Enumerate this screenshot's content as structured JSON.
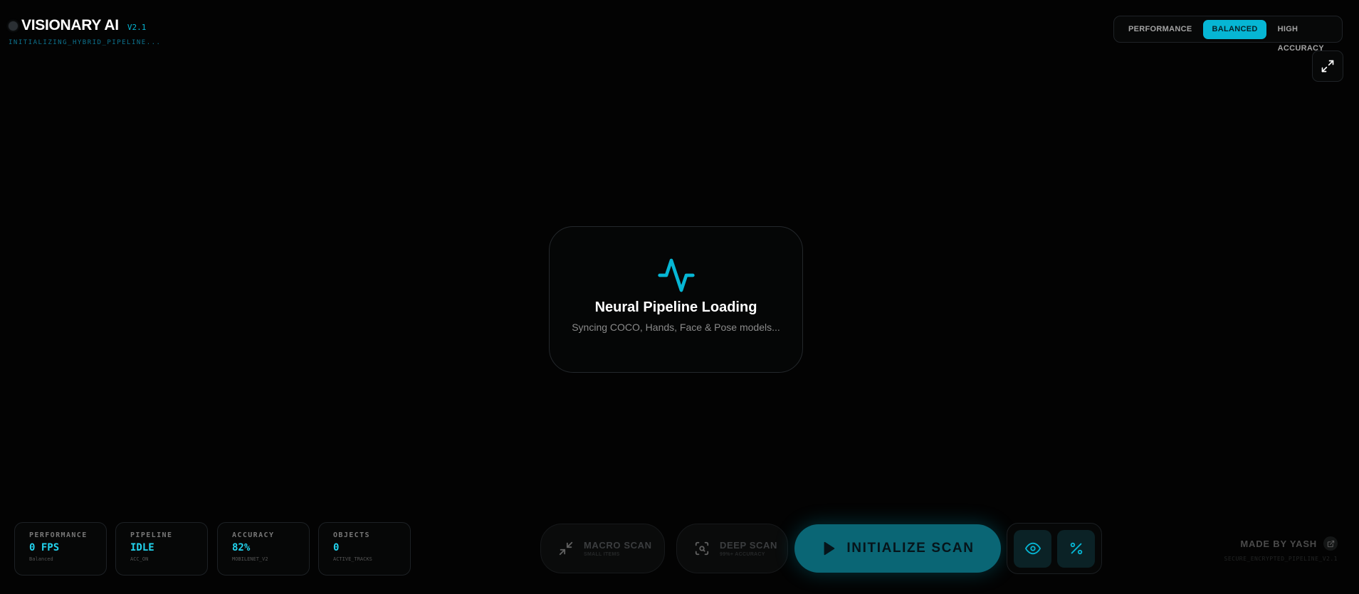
{
  "header": {
    "title": "VISIONARY AI",
    "version": "V2.1",
    "status": "INITIALIZING_HYBRID_PIPELINE..."
  },
  "mode_switch": {
    "options": [
      "PERFORMANCE",
      "BALANCED",
      "HIGH ACCURACY"
    ],
    "selected": "BALANCED"
  },
  "loader": {
    "title": "Neural Pipeline Loading",
    "subtitle": "Syncing COCO, Hands, Face & Pose models..."
  },
  "stats": [
    {
      "label": "PERFORMANCE",
      "value": "0 FPS",
      "sub": "Balanced"
    },
    {
      "label": "PIPELINE",
      "value": "IDLE",
      "sub": "ACC_ON"
    },
    {
      "label": "ACCURACY",
      "value": "82%",
      "sub": "MOBILENET_V2"
    },
    {
      "label": "OBJECTS",
      "value": "0",
      "sub": "ACTIVE_TRACKS"
    }
  ],
  "controls": {
    "macro": {
      "title": "MACRO SCAN",
      "sub": "SMALL ITEMS"
    },
    "deep": {
      "title": "DEEP SCAN",
      "sub": "99%+ ACCURACY"
    },
    "init": "INITIALIZE SCAN"
  },
  "credit": {
    "name": "MADE BY YASH",
    "sub": "SECURE_ENCRYPTED_PIPELINE_V2.1"
  },
  "colors": {
    "accent": "#06b6d4",
    "background": "#030303"
  }
}
